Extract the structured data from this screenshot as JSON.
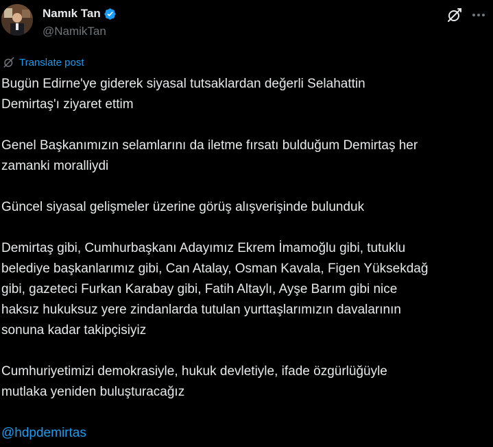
{
  "author": {
    "display_name": "Namık Tan",
    "handle": "@NamikTan",
    "verified": true
  },
  "actions": {
    "translate_label": "Translate post"
  },
  "post": {
    "paragraphs": [
      "Bugün Edirne'ye giderek siyasal tutsaklardan değerli Selahattin\nDemirtaş'ı ziyaret ettim",
      "Genel Başkanımızın selamlarını da iletme fırsatı bulduğum Demirtaş her\nzamanki moralliydi",
      "Güncel siyasal gelişmeler üzerine görüş alışverişinde bulunduk",
      "Demirtaş gibi, Cumhurbaşkanı Adayımız Ekrem İmamoğlu gibi, tutuklu\nbelediye başkanlarımız gibi, Can Atalay, Osman Kavala, Figen Yüksekdağ\ngibi, gazeteci Furkan Karabay gibi, Fatih Altaylı, Ayşe Barım gibi nice\nhaksız hukuksuz yere zindanlarda tutulan yurttaşlarımızın davalarının\nsonuna kadar takipçisiyiz",
      "Cumhuriyetimizi demokrasiyle, hukuk devletiyle, ifade özgürlüğüyle\nmutlaka yeniden buluşturacağız"
    ],
    "mention": "@hdpdemirtas"
  },
  "colors": {
    "background": "#000000",
    "text": "#e7e9ea",
    "secondary": "#71767b",
    "accent": "#1d9bf0"
  },
  "icons": {
    "verified": "verified-badge-icon",
    "grok": "grok-icon",
    "more": "more-icon",
    "translate": "translate-icon"
  }
}
